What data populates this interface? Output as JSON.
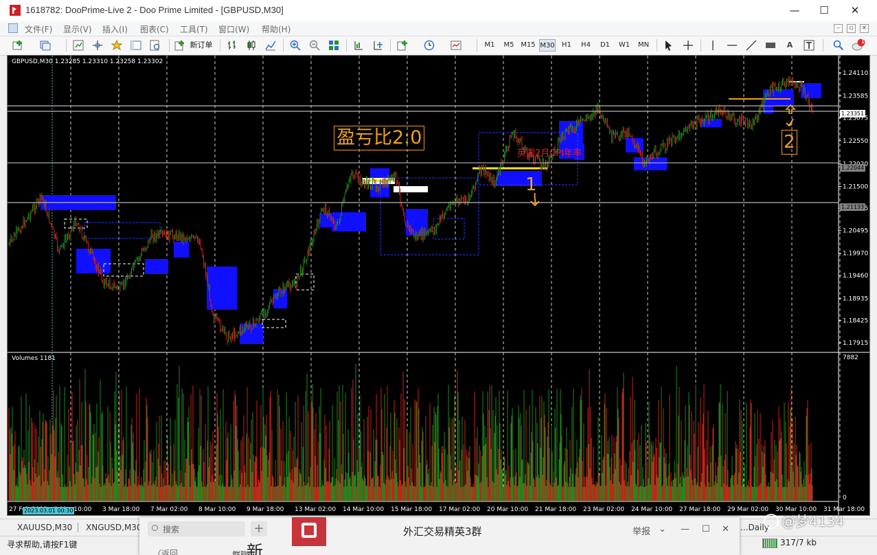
{
  "window": {
    "title": "1618782: DooPrime-Live 2 - Doo Prime Limited - [GBPUSD,M30]",
    "minimize": "—",
    "maximize": "☐",
    "close": "✕"
  },
  "menu": [
    "文件(F)",
    "显示(V)",
    "插入(I)",
    "图表(C)",
    "工具(T)",
    "窗口(W)",
    "帮助(H)"
  ],
  "toolbar": {
    "new_order_label": "新订单",
    "timeframes": [
      "M1",
      "M5",
      "M15",
      "M30",
      "H1",
      "H4",
      "D1",
      "W1",
      "MN"
    ],
    "selected_timeframe": "M30",
    "alert_count": "1"
  },
  "chart": {
    "ohlc_header": "GBPUSD,M30  1.23285 1.23310 1.23258 1.23302",
    "volume_header": "Volumes 1181",
    "price_labels": [
      "1.24110",
      "1.23585",
      "1.23075",
      "1.22550",
      "1.22020",
      "1.21500",
      "1.21005",
      "1.20495",
      "1.19970",
      "1.19460",
      "1.18935",
      "1.18425",
      "1.17915"
    ],
    "level_badges": [
      {
        "text": "1.23351",
        "kind": "current"
      },
      {
        "text": "1.22044",
        "kind": "line"
      },
      {
        "text": "1.21133",
        "kind": "line"
      }
    ],
    "volume_scale": [
      "7882",
      "0"
    ],
    "date_labels": [
      "27 Feb 2023",
      "2 Mar 10:00",
      "3 Mar 18:00",
      "7 Mar 02:00",
      "8 Mar 10:00",
      "9 Mar 18:00",
      "13 Mar 02:00",
      "14 Mar 10:00",
      "15 Mar 18:00",
      "17 Mar 02:00",
      "20 Mar 10:00",
      "21 Mar 18:00",
      "23 Mar 02:00",
      "24 Mar 10:00",
      "27 Mar 18:00",
      "29 Mar 02:00",
      "30 Mar 10:00",
      "31 Mar 18:00"
    ],
    "cursor_date": "2023.03.01 00:30",
    "annotation_ratio": "盈亏比2:0",
    "annotation_red": "英国2月CPI年率",
    "mark_1": "1",
    "mark_2": "2",
    "colors": {
      "bg": "#000000",
      "bull": "#1d8a1d",
      "bear": "#c8221a",
      "box": "#1010ff",
      "accent": "#f0a020"
    }
  },
  "tabs": [
    "XAUUSD,M30",
    "XNGUSD,M30"
  ],
  "tab_right": "...Daily",
  "status": {
    "help_text": "寻求帮助,请按F1键",
    "traffic": "317/7 kb"
  },
  "chat": {
    "search_placeholder": "搜索",
    "add": "+",
    "group_title": "外汇交易精英3群",
    "report": "举报",
    "back": "〈返回",
    "partial": "群聊"
  },
  "watermark": "@梦4134"
}
